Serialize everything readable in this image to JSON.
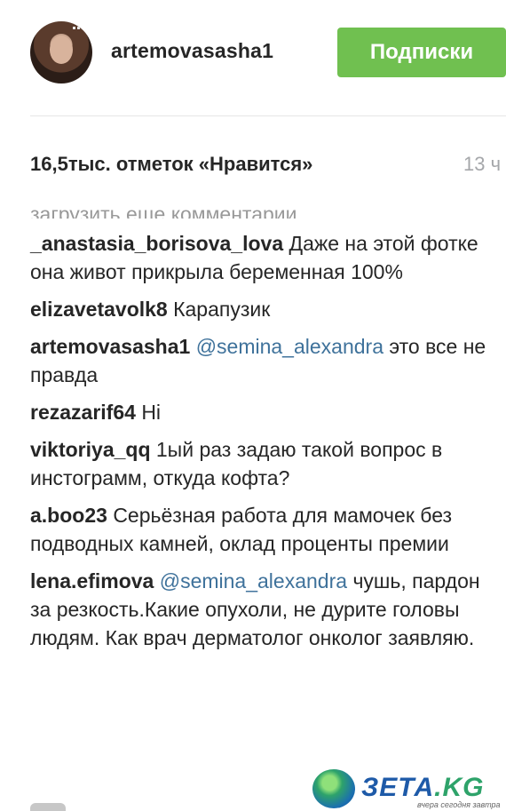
{
  "header": {
    "username": "artemovasasha1",
    "follow_label": "Подписки"
  },
  "post": {
    "likes": "16,5тыс. отметок «Нравится»",
    "time": "13 ч"
  },
  "comments": {
    "load_more": "загрузить еще комментарии",
    "items": [
      {
        "user": "_anastasia_borisova_lova",
        "mention": "",
        "text": "Даже на этой фотке она живот прикрыла беременная 100%"
      },
      {
        "user": "elizavetavolk8",
        "mention": "",
        "text": "Карапузик"
      },
      {
        "user": "artemovasasha1",
        "mention": "@semina_alexandra",
        "text": "это все не правда"
      },
      {
        "user": "rezazarif64",
        "mention": "",
        "text": "Hi"
      },
      {
        "user": "viktoriya_qq",
        "mention": "",
        "text": "1ый раз задаю такой вопрос в инстограмм, откуда кофта?"
      },
      {
        "user": "a.boo23",
        "mention": "",
        "text": "Серьёзная работа для мамочек без подводных камней, оклад проценты премии"
      },
      {
        "user": "lena.efimova",
        "mention": "@semina_alexandra",
        "text": "чушь, пардон за резкость.Какие опухоли, не дурите головы людям. Как врач дерматолог онколог заявляю."
      }
    ]
  },
  "watermark": {
    "brand": "ЗЕТА",
    "tld": ".KG",
    "tagline": "вчера сегодня завтра"
  },
  "colors": {
    "follow_button": "#70c050",
    "mention": "#3f729b",
    "muted": "#999999"
  },
  "icons": [
    "avatar",
    "globe-logo-icon"
  ]
}
